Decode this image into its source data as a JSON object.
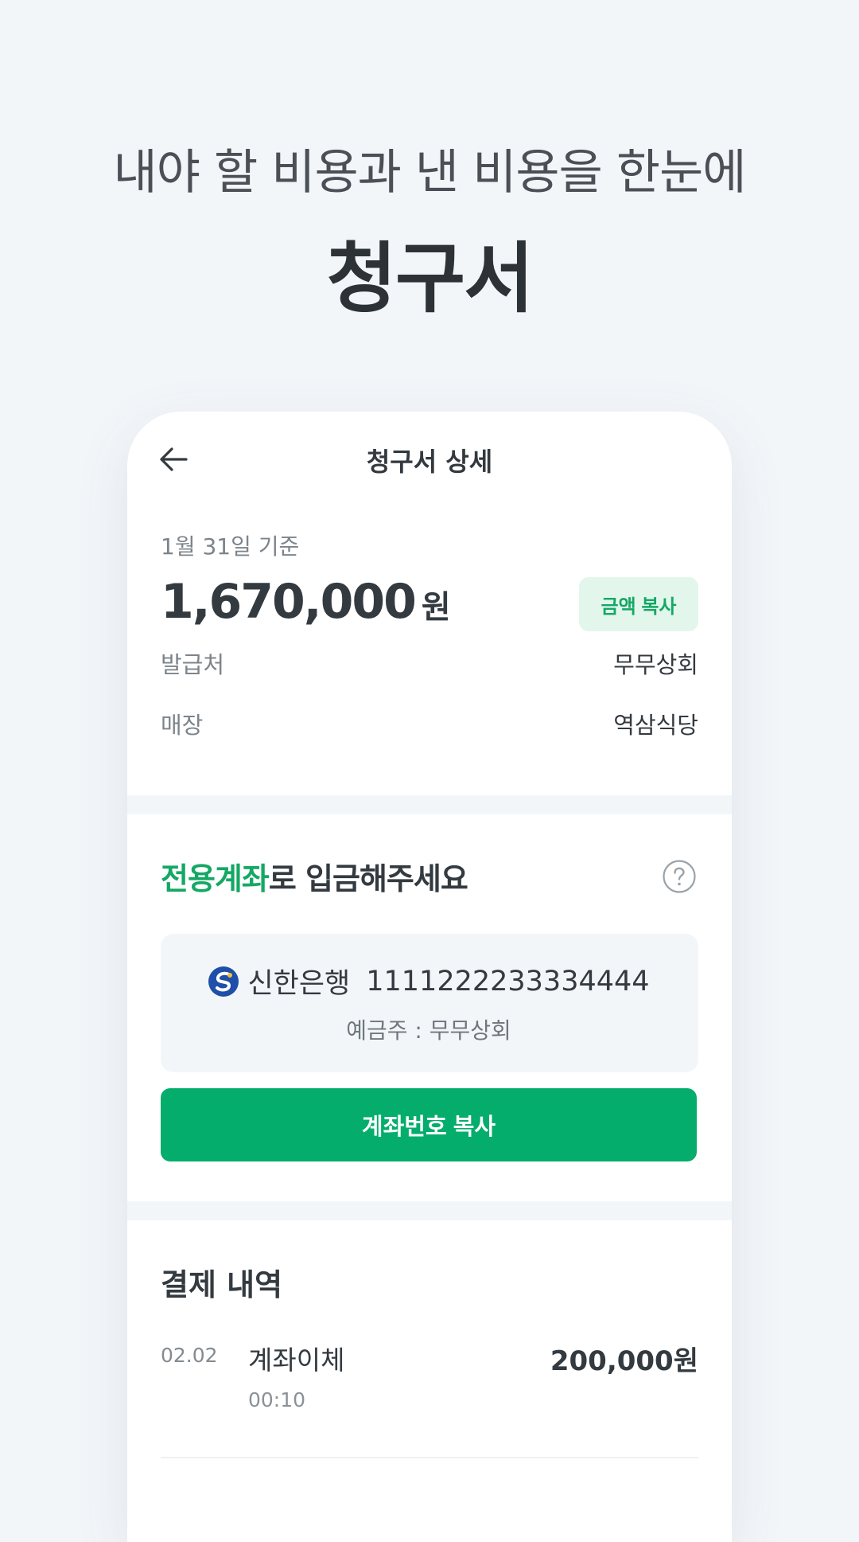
{
  "promo": {
    "subtitle": "내야 할 비용과 낸 비용을 한눈에",
    "title": "청구서"
  },
  "screen": {
    "title": "청구서 상세",
    "back_icon": "arrow-left-icon"
  },
  "summary": {
    "basis": "1월 31일 기준",
    "amount": "1,670,000",
    "unit": "원",
    "copy_amount_label": "금액 복사",
    "issuer_label": "발급처",
    "issuer_value": "무무상회",
    "store_label": "매장",
    "store_value": "역삼식당"
  },
  "deposit": {
    "title_accent": "전용계좌",
    "title_rest": "로 입금해주세요",
    "help_icon": "question-circle-icon",
    "bank_logo": "shinhan-bank-logo",
    "bank_name": "신한은행",
    "account_number": "1111222233334444",
    "holder": "예금주 : 무무상회",
    "copy_account_label": "계좌번호 복사"
  },
  "payments": {
    "title": "결제 내역",
    "items": [
      {
        "date": "02.02",
        "method": "계좌이체",
        "time": "00:10",
        "amount": "200,000원"
      }
    ]
  },
  "colors": {
    "accent": "#04ad6c",
    "accent_text": "#14a864",
    "accent_soft": "#e3f6ec",
    "background": "#f3f6f9",
    "text_primary": "#333a40",
    "text_secondary": "#7c848b"
  }
}
